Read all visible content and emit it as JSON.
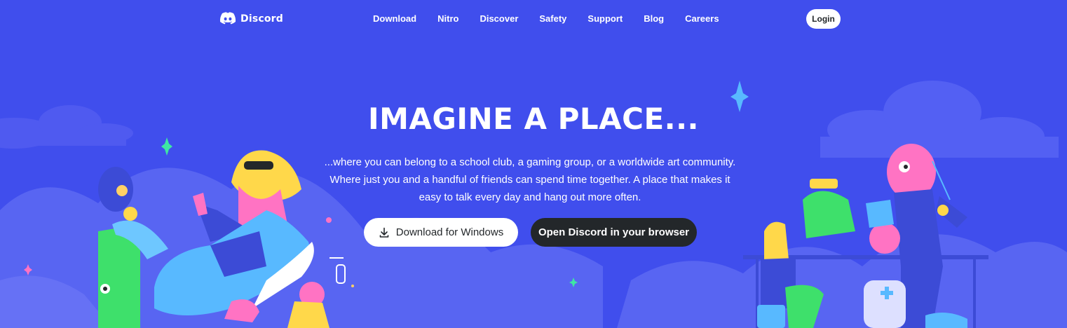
{
  "brand": {
    "name": "Discord",
    "logo_icon": "discord-logo-icon"
  },
  "nav": {
    "links": [
      "Download",
      "Nitro",
      "Discover",
      "Safety",
      "Support",
      "Blog",
      "Careers"
    ],
    "login_label": "Login"
  },
  "hero": {
    "title": "IMAGINE A PLACE...",
    "description": "...where you can belong to a school club, a gaming group, or a worldwide art community. Where just you and a handful of friends can spend time together. A place that makes it easy to talk every day and hang out more often.",
    "download_button": "Download for Windows",
    "download_icon": "download-icon",
    "browser_button": "Open Discord in your browser"
  },
  "colors": {
    "background": "#404eed",
    "hills": "#5865f2",
    "dark_button": "#23272a",
    "white": "#ffffff"
  }
}
